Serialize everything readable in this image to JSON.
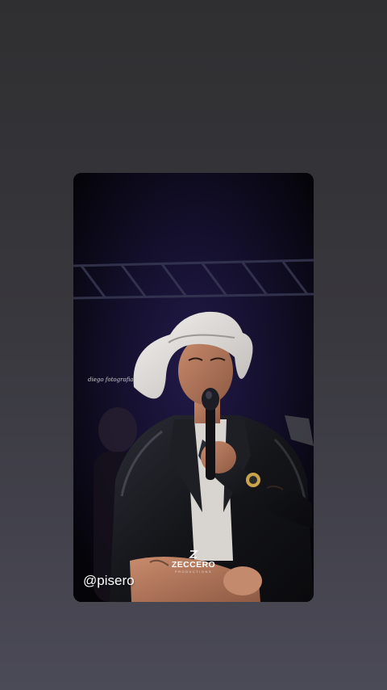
{
  "story": {
    "mention": "@pisero",
    "signature": "diego fotografia",
    "logo": {
      "name": "ZECCERO",
      "subtitle": "PRODUCTIONS"
    }
  },
  "colors": {
    "background_top": "#2f2f31",
    "background_bottom": "#4b4a57",
    "stage_dark": "#07060c",
    "stage_purple": "#2a1f5e",
    "hat": "#e9e7e4",
    "jacket": "#1a1a1e"
  },
  "icons": {
    "logo_mark": "zeccero-logo-icon",
    "microphone": "microphone-icon"
  }
}
